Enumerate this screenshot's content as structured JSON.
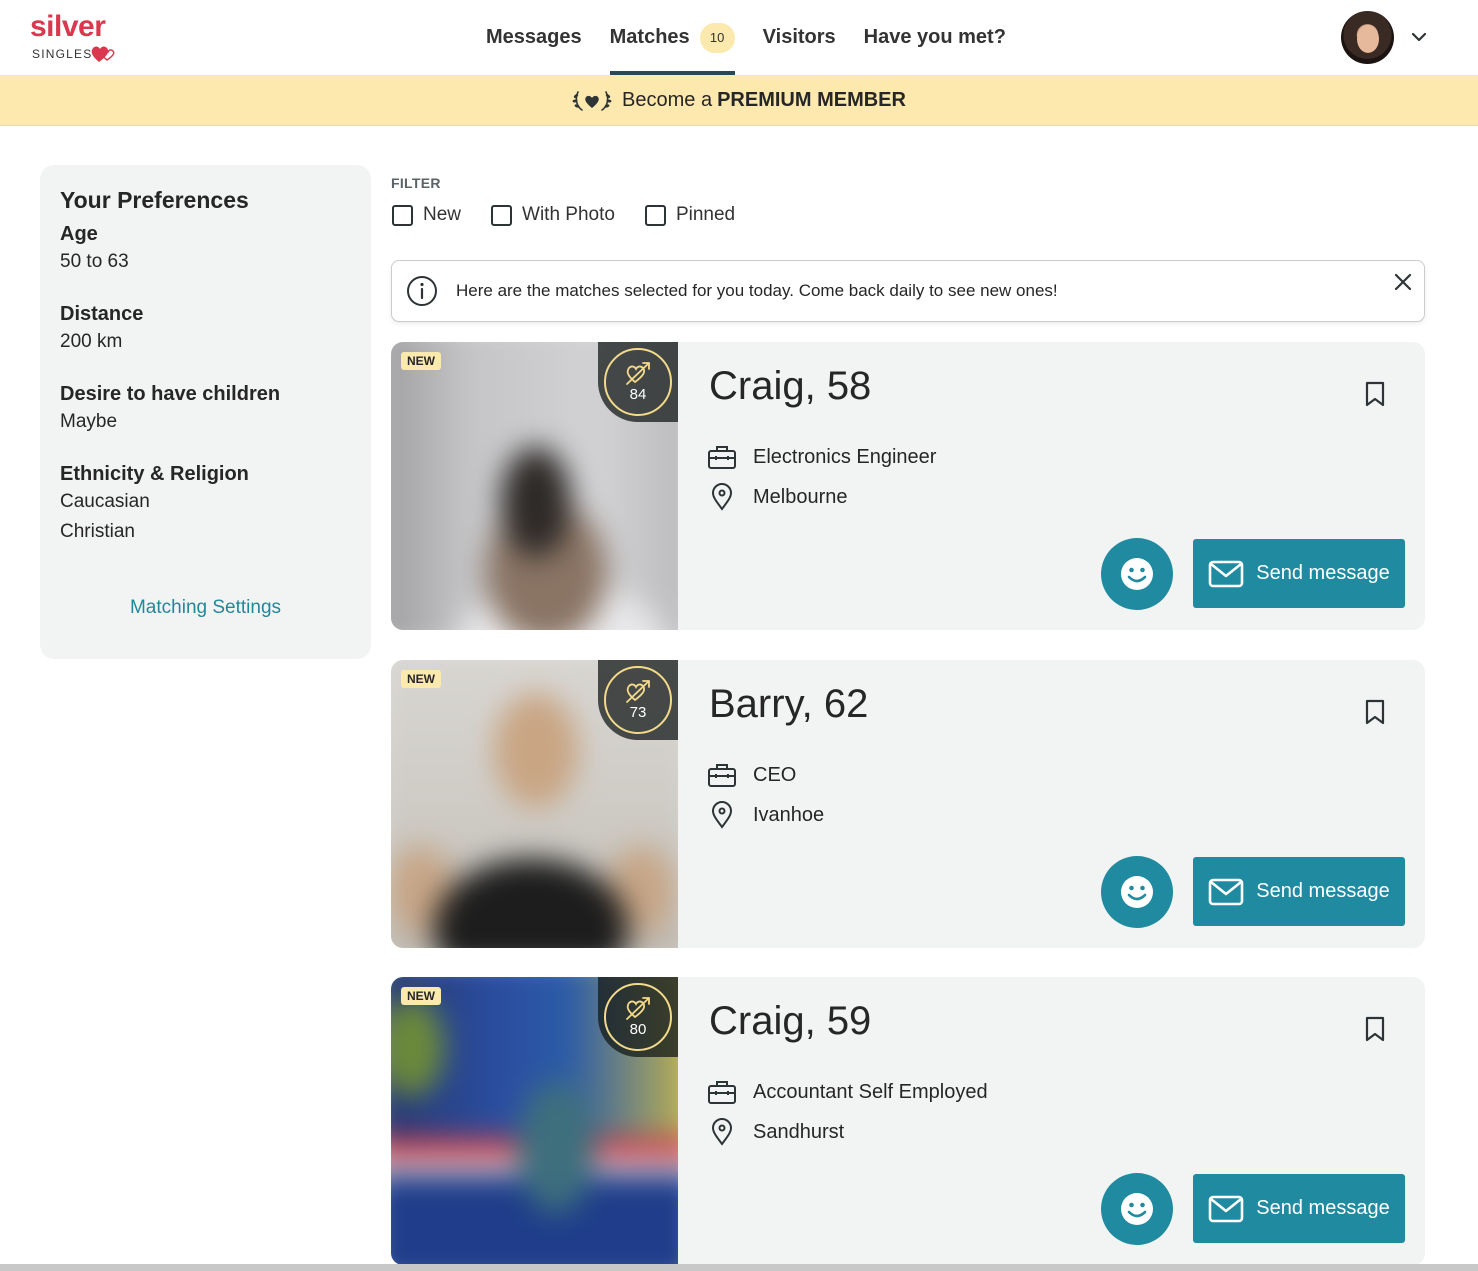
{
  "brand": {
    "name": "silver",
    "sub": "SINGLES"
  },
  "nav": {
    "messages": "Messages",
    "matches": "Matches",
    "matches_count": "10",
    "visitors": "Visitors",
    "have_you_met": "Have you met?"
  },
  "premium": {
    "prefix": "Become a",
    "highlight": "PREMIUM MEMBER"
  },
  "preferences": {
    "title": "Your Preferences",
    "age_label": "Age",
    "age_value": "50 to 63",
    "distance_label": "Distance",
    "distance_value": "200 km",
    "children_label": "Desire to have children",
    "children_value": "Maybe",
    "ethnicity_label": "Ethnicity & Religion",
    "ethnicity_value": "Caucasian",
    "religion_value": "Christian",
    "settings_link": "Matching Settings"
  },
  "filter": {
    "title": "FILTER",
    "options": [
      "New",
      "With Photo",
      "Pinned"
    ]
  },
  "info": {
    "text": "Here are the matches selected for you today. Come back daily to see new ones!"
  },
  "cards": [
    {
      "badge": "NEW",
      "score": "84",
      "name": "Craig, 58",
      "job": "Electronics Engineer",
      "location": "Melbourne",
      "send_label": "Send message"
    },
    {
      "badge": "NEW",
      "score": "73",
      "name": "Barry, 62",
      "job": "CEO",
      "location": "Ivanhoe",
      "send_label": "Send message"
    },
    {
      "badge": "NEW",
      "score": "80",
      "name": "Craig, 59",
      "job": "Accountant Self Employed",
      "location": "Sandhurst",
      "send_label": "Send message"
    }
  ],
  "colors": {
    "brand": "#d9384f",
    "accent": "#1f8aa0",
    "premium_bg": "#fde9ae",
    "badge_bg": "#fbe9ad",
    "nav_underline": "#264a4f"
  },
  "icons": {
    "info": "info-circle-icon",
    "close": "close-icon",
    "job": "briefcase-icon",
    "location": "map-pin-icon",
    "bookmark": "bookmark-icon",
    "smile": "smiley-icon",
    "mail": "envelope-icon",
    "score": "heart-arrow-icon",
    "premium": "laurel-heart-icon",
    "chevron": "chevron-down-icon"
  }
}
